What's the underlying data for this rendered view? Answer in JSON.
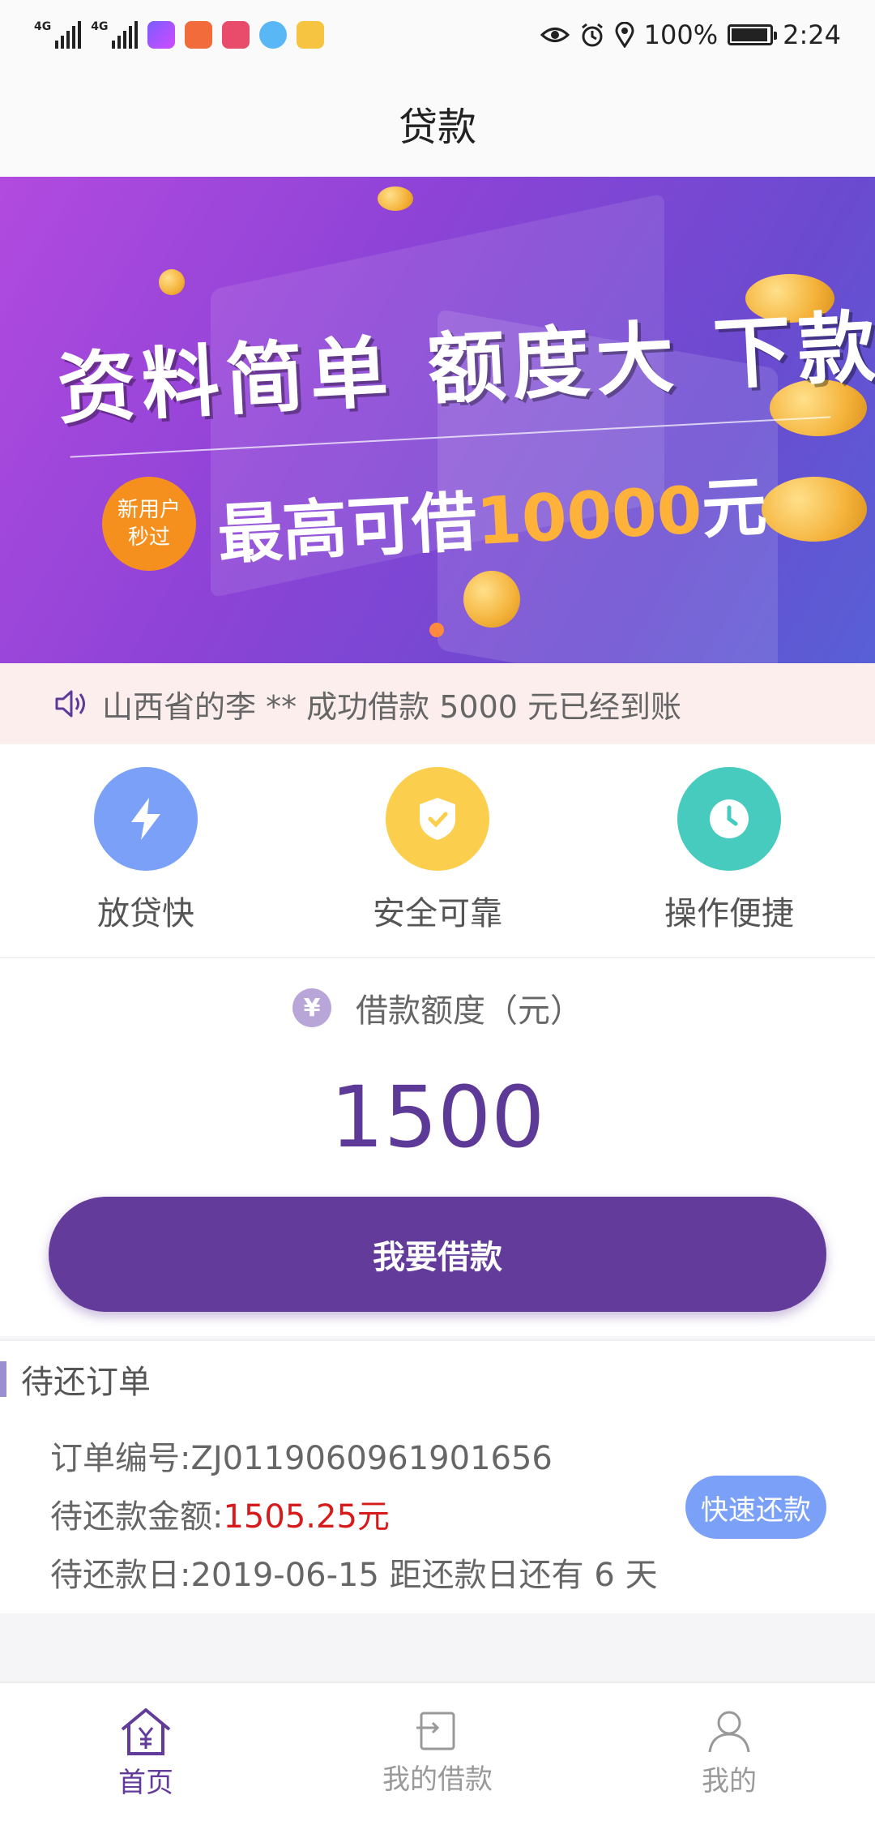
{
  "status_bar": {
    "network1": "4G",
    "network2": "4G",
    "battery": "100%",
    "battery_level": 1.0,
    "time": "2:24",
    "icons": [
      "eye-icon",
      "alarm-icon",
      "location-icon"
    ]
  },
  "nav": {
    "title": "贷款"
  },
  "banner": {
    "headline": "资料简单 额度大 下款快",
    "badge_line1": "新用户",
    "badge_line2": "秒过",
    "sub_prefix": "最高可借",
    "sub_amount": "10000",
    "sub_suffix": "元"
  },
  "notice": {
    "text": "山西省的李 ** 成功借款 5000 元已经到账"
  },
  "features": [
    {
      "label": "放贷快",
      "icon": "lightning-icon",
      "color": "#7aa1f7"
    },
    {
      "label": "安全可靠",
      "icon": "shield-check-icon",
      "color": "#fbcf4d"
    },
    {
      "label": "操作便捷",
      "icon": "clock-icon",
      "color": "#48cbbf"
    }
  ],
  "credit": {
    "label": "借款额度（元）",
    "amount": "1500",
    "button": "我要借款"
  },
  "order": {
    "title": "待还订单",
    "number_label": "订单编号:",
    "number": "ZJ0119060961901656",
    "amount_label": "待还款金额:",
    "amount": "1505.25元",
    "due_label": "待还款日:",
    "due_date": "2019-06-15",
    "remain_prefix": "距还款日还有",
    "remain_days": "6",
    "remain_suffix": "天",
    "repay_button": "快速还款"
  },
  "tabs": [
    {
      "label": "首页",
      "icon": "home-yen-icon",
      "active": true
    },
    {
      "label": "我的借款",
      "icon": "loan-list-icon",
      "active": false
    },
    {
      "label": "我的",
      "icon": "user-icon",
      "active": false
    }
  ],
  "colors": {
    "primary": "#633b9b",
    "amount_red": "#d71b1b",
    "repay_blue": "#7aa1f7",
    "notice_bg": "#fdeeee"
  }
}
